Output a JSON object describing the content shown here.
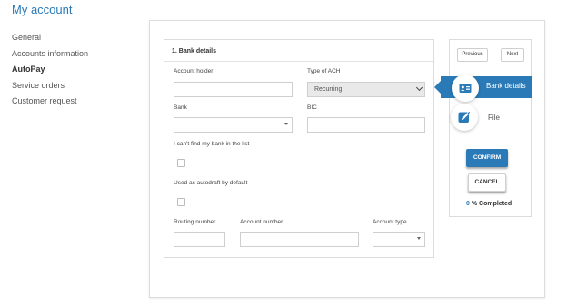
{
  "page": {
    "title": "My account"
  },
  "sidebar": {
    "items": [
      {
        "label": "General"
      },
      {
        "label": "Accounts information"
      },
      {
        "label": "AutoPay",
        "active": true
      },
      {
        "label": "Service orders"
      },
      {
        "label": "Customer request"
      }
    ]
  },
  "form": {
    "section_title": "1. Bank details",
    "account_holder": {
      "label": "Account holder",
      "value": ""
    },
    "ach_type": {
      "label": "Type of ACH",
      "value": "Recurring"
    },
    "bank": {
      "label": "Bank",
      "value": ""
    },
    "bic": {
      "label": "BIC",
      "value": ""
    },
    "bank_not_found": {
      "label": "I can't find my bank in the list",
      "checked": false
    },
    "autodraft_default": {
      "label": "Used as autodraft by default",
      "checked": false
    },
    "routing_number": {
      "label": "Routing number",
      "value": ""
    },
    "account_number": {
      "label": "Account number",
      "value": ""
    },
    "account_type": {
      "label": "Account type",
      "value": ""
    }
  },
  "wizard": {
    "previous_label": "Previous",
    "next_label": "Next",
    "steps": [
      {
        "label": "Bank details",
        "icon": "id-card-icon",
        "active": true
      },
      {
        "label": "File",
        "icon": "edit-icon",
        "active": false
      }
    ],
    "confirm_label": "CONFIRM",
    "cancel_label": "CANCEL",
    "progress_value": "0",
    "progress_suffix": " % Completed"
  },
  "colors": {
    "accent": "#2a7ab8"
  }
}
